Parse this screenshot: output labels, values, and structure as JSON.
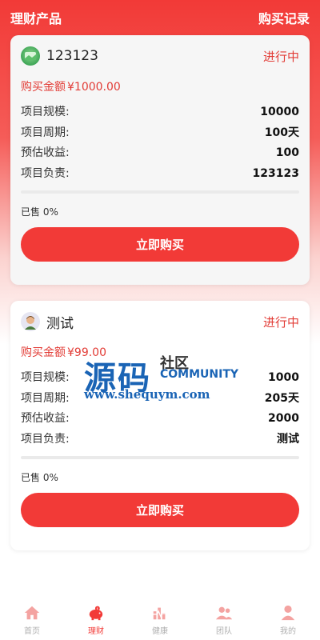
{
  "header": {
    "title": "理财产品",
    "records_link": "购买记录"
  },
  "products": [
    {
      "name": "123123",
      "status": "进行中",
      "amount_label": "购买金额",
      "amount_value": "¥1000.00",
      "fields": [
        {
          "label": "项目规模:",
          "value": "10000"
        },
        {
          "label": "项目周期:",
          "value": "100天"
        },
        {
          "label": "预估收益:",
          "value": "100"
        },
        {
          "label": "项目负责:",
          "value": "123123"
        }
      ],
      "progress": 0,
      "sold": "已售 0%",
      "buy_label": "立即购买",
      "avatar_icon": "green-landscape-icon"
    },
    {
      "name": "测试",
      "status": "进行中",
      "amount_label": "购买金额",
      "amount_value": "¥99.00",
      "fields": [
        {
          "label": "项目规模:",
          "value": "1000"
        },
        {
          "label": "项目周期:",
          "value": "205天"
        },
        {
          "label": "预估收益:",
          "value": "2000"
        },
        {
          "label": "项目负责:",
          "value": "测试"
        }
      ],
      "progress": 0,
      "sold": "已售 0%",
      "buy_label": "立即购买",
      "avatar_icon": "person-icon"
    }
  ],
  "watermark": {
    "big": "源码",
    "small": "社区",
    "community": "COMMUNITY",
    "url": "www.shequym.com"
  },
  "tabbar": [
    {
      "label": "首页",
      "icon": "home-icon",
      "active": false
    },
    {
      "label": "理财",
      "icon": "piggy-bank-icon",
      "active": true
    },
    {
      "label": "健康",
      "icon": "health-chart-icon",
      "active": false
    },
    {
      "label": "团队",
      "icon": "team-icon",
      "active": false
    },
    {
      "label": "我的",
      "icon": "user-icon",
      "active": false
    }
  ],
  "colors": {
    "accent": "#f23a37",
    "tab_inactive": "#b0b0b0",
    "watermark_blue": "#1a64b5"
  }
}
